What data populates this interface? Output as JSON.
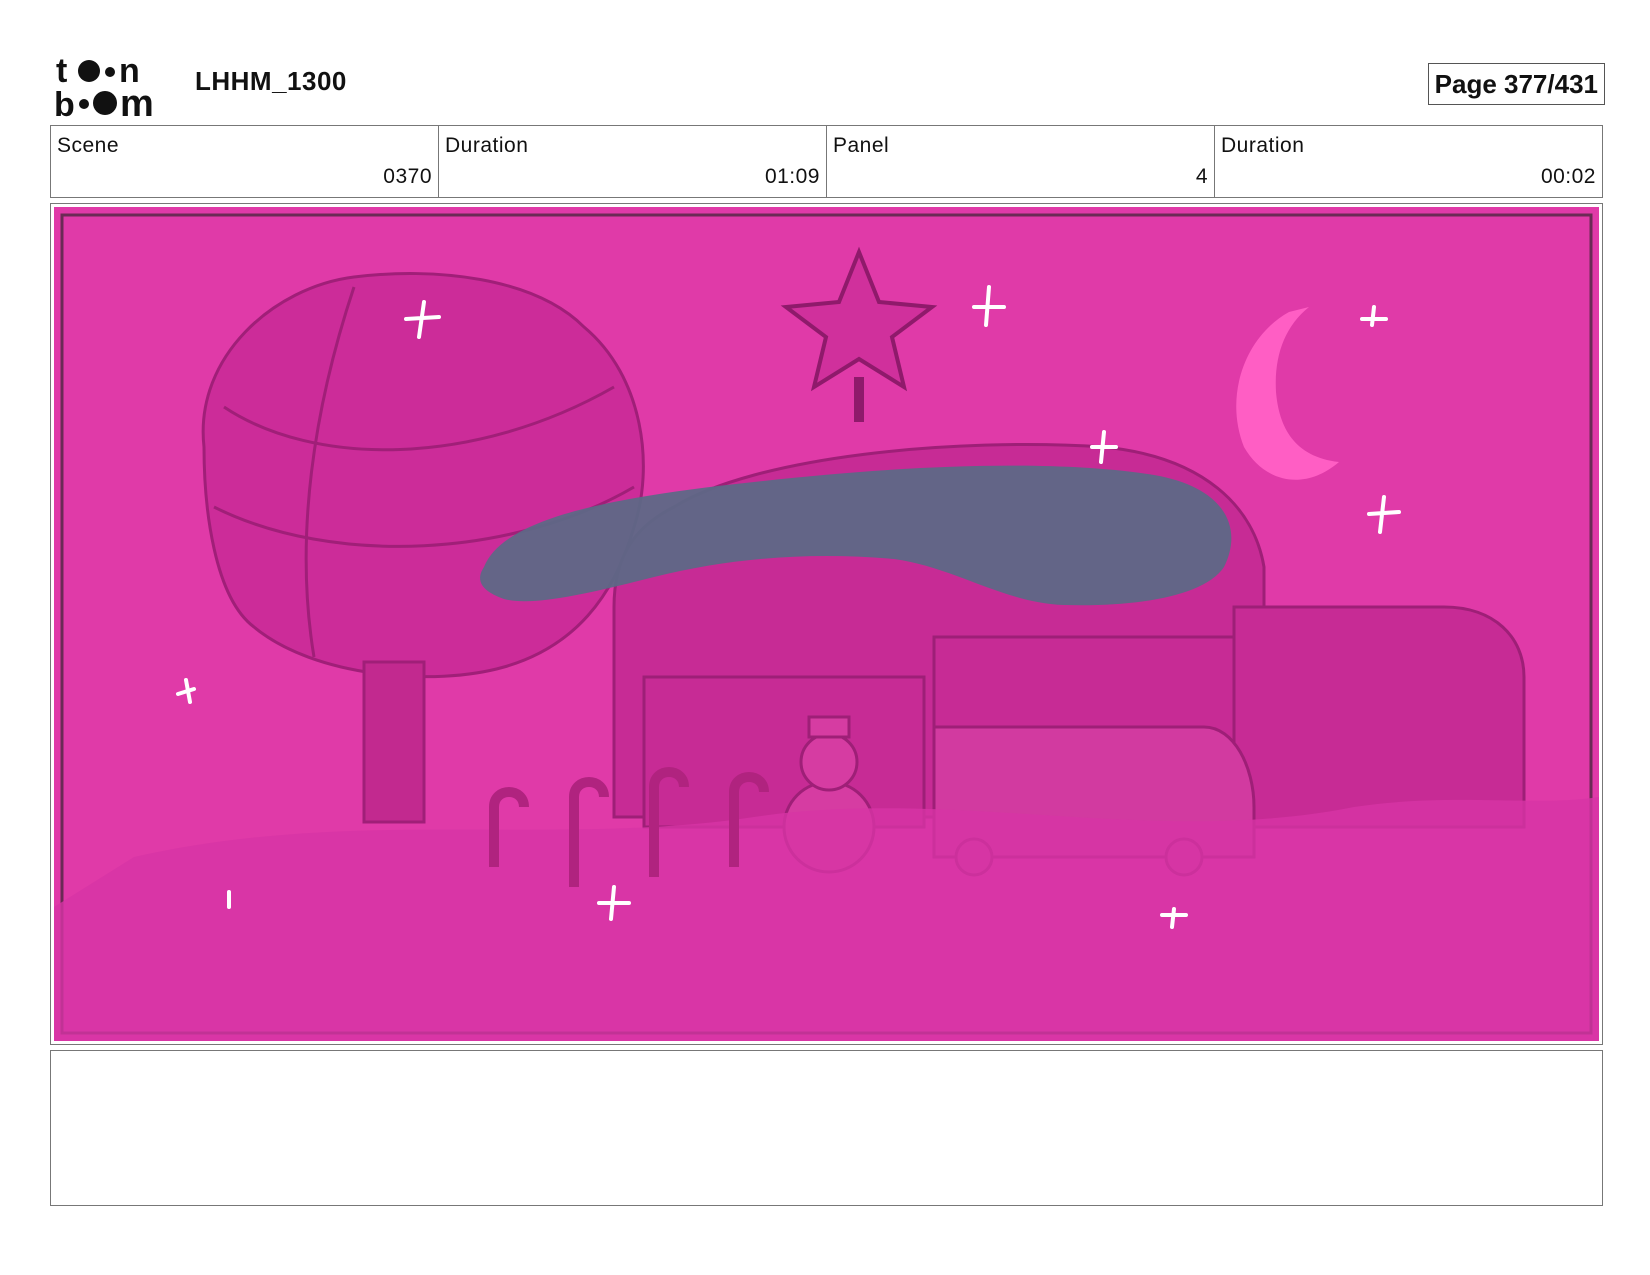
{
  "header": {
    "logo_text": "toonboom",
    "project_title": "LHHM_1300",
    "page_counter": "Page 377/431"
  },
  "info": {
    "scene_label": "Scene",
    "scene_value": "0370",
    "scene_duration_label": "Duration",
    "scene_duration_value": "01:09",
    "panel_label": "Panel",
    "panel_value": "4",
    "panel_duration_label": "Duration",
    "panel_duration_value": "00:02"
  },
  "panel": {
    "background_color": "#e03aa8",
    "dark_overlay_color": "#5e6886",
    "moon_color": "#ff5ec4"
  },
  "notes": {
    "text": ""
  }
}
